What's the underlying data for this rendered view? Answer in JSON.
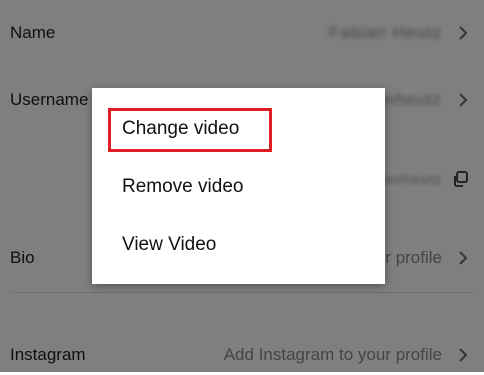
{
  "profile": {
    "rows": [
      {
        "label": "Name",
        "value": "Fabian Heutz"
      },
      {
        "label": "Username",
        "value": "fabianheutz"
      },
      {
        "label": "",
        "value": "tiktok.com/@fabianheutz"
      },
      {
        "label": "Bio",
        "value": "Add a bio to your profile"
      },
      {
        "label": "Instagram",
        "value": "Add Instagram to your profile"
      }
    ]
  },
  "menu": {
    "items": [
      {
        "label": "Change video"
      },
      {
        "label": "Remove video"
      },
      {
        "label": "View Video"
      }
    ]
  },
  "highlight_color": "#e01e26",
  "icons": [
    "chevron-right-icon",
    "copy-icon"
  ]
}
